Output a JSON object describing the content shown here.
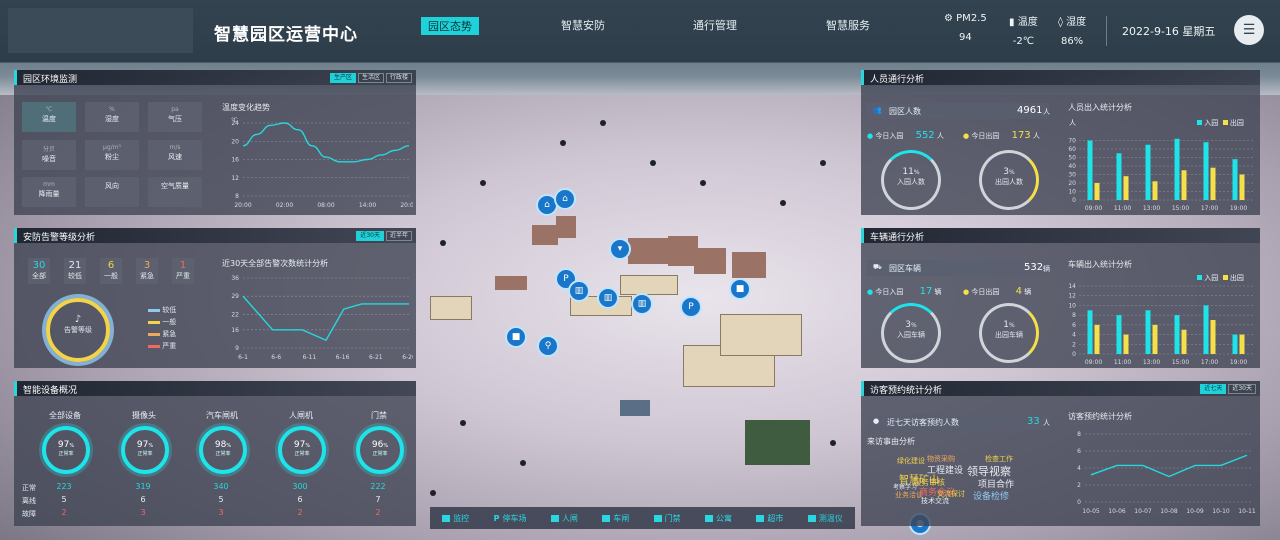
{
  "header": {
    "title": "智慧园区运营中心",
    "nav": [
      "园区态势",
      "智慧安防",
      "通行管理",
      "智慧服务"
    ],
    "active_nav": 0,
    "env": [
      {
        "label": "PM2.5",
        "value": "94",
        "icon": "pm25-icon"
      },
      {
        "label": "温度",
        "value": "-2℃",
        "icon": "thermometer-icon"
      },
      {
        "label": "湿度",
        "value": "86%",
        "icon": "humidity-icon"
      }
    ],
    "datetime": "2022-9-16 星期五"
  },
  "env_monitor": {
    "title": "园区环境监测",
    "tags": [
      "生产区",
      "生活区",
      "行政楼"
    ],
    "active_tag": 0,
    "cells": [
      {
        "unit": "℃",
        "label": "温度"
      },
      {
        "unit": "%",
        "label": "湿度"
      },
      {
        "unit": "pa",
        "label": "气压"
      },
      {
        "unit": "分贝",
        "label": "噪音"
      },
      {
        "unit": "μg/m³",
        "label": "粉尘"
      },
      {
        "unit": "m/s",
        "label": "风速"
      },
      {
        "unit": "mm",
        "label": "降雨量"
      },
      {
        "unit": "",
        "label": "风向"
      },
      {
        "unit": "",
        "label": "空气质量"
      }
    ],
    "chart_title": "温度变化趋势"
  },
  "alarm": {
    "title": "安防告警等级分析",
    "tags": [
      "近30天",
      "近半年"
    ],
    "active_tag": 0,
    "counts": [
      {
        "n": "30",
        "label": "全部",
        "color": "#27d7dc"
      },
      {
        "n": "21",
        "label": "较低",
        "color": "#e6eef2"
      },
      {
        "n": "6",
        "label": "一般",
        "color": "#f3d34a"
      },
      {
        "n": "3",
        "label": "紧急",
        "color": "#f0a85c"
      },
      {
        "n": "1",
        "label": "严重",
        "color": "#ef6b5c"
      }
    ],
    "gauge_label": "告警等级",
    "legend": [
      {
        "label": "较低",
        "color": "#8fc8f2"
      },
      {
        "label": "一般",
        "color": "#f3d34a"
      },
      {
        "label": "紧急",
        "color": "#f0a85c"
      },
      {
        "label": "严重",
        "color": "#ef6b5c"
      }
    ],
    "chart_title": "近30天全部告警次数统计分析"
  },
  "devices": {
    "title": "智能设备概况",
    "items": [
      {
        "name": "全部设备",
        "pct": "97",
        "normal": "223",
        "offline": "5",
        "fault": "2"
      },
      {
        "name": "摄像头",
        "pct": "97",
        "normal": "319",
        "offline": "6",
        "fault": "3"
      },
      {
        "name": "汽车闸机",
        "pct": "98",
        "normal": "340",
        "offline": "5",
        "fault": "3"
      },
      {
        "name": "人闸机",
        "pct": "97",
        "normal": "300",
        "offline": "6",
        "fault": "2"
      },
      {
        "name": "门禁",
        "pct": "96",
        "normal": "222",
        "offline": "7",
        "fault": "2"
      }
    ],
    "pct_unit": "%",
    "rate_label": "正常率",
    "row_labels": [
      "正常",
      "离线",
      "故障"
    ]
  },
  "people": {
    "title": "人员通行分析",
    "count_label": "园区人数",
    "count": "4961",
    "count_unit": "人",
    "in_label": "今日入园",
    "in_value": "552",
    "out_label": "今日出园",
    "out_value": "173",
    "unit": "人",
    "ring_in": {
      "pct": "11",
      "label": "入园人数"
    },
    "ring_out": {
      "pct": "3",
      "label": "出园人数"
    },
    "chart_title": "人员出入统计分析",
    "legend": [
      "入园",
      "出园"
    ],
    "yunit": "人"
  },
  "vehicles": {
    "title": "车辆通行分析",
    "count_label": "园区车辆",
    "count": "532",
    "count_unit": "辆",
    "in_label": "今日入园",
    "in_value": "17",
    "out_label": "今日出园",
    "out_value": "4",
    "unit": "辆",
    "ring_in": {
      "pct": "3",
      "label": "入园车辆"
    },
    "ring_out": {
      "pct": "1",
      "label": "出园车辆"
    },
    "chart_title": "车辆出入统计分析",
    "legend": [
      "入园",
      "出园"
    ]
  },
  "visitors": {
    "title": "访客预约统计分析",
    "tags": [
      "近七天",
      "近30天"
    ],
    "active_tag": 0,
    "count_label": "近七天访客预约人数",
    "count": "33",
    "count_unit": "人",
    "cloud_title": "来访事由分析",
    "words": [
      "领导视察",
      "工程建设",
      "物资采购",
      "项目合作",
      "智慧矿山",
      "绿化建设",
      "业务洽谈",
      "商务会议",
      "交流探讨",
      "技术交流",
      "服务审核",
      "设备检修",
      "检查工作",
      "考察学习"
    ],
    "chart_title": "访客预约统计分析"
  },
  "bottom_bar": [
    "监控",
    "停车场",
    "人闸",
    "车闸",
    "门禁",
    "公寓",
    "超市",
    "测温仪"
  ],
  "percent_sign": "%",
  "colors": {
    "accent": "#27d7dc",
    "in": "#1ee3e8",
    "out": "#f5e04a"
  },
  "chart_data": [
    {
      "type": "line",
      "id": "temp",
      "x": [
        "20:00",
        "02:00",
        "08:00",
        "14:00",
        "20:00"
      ],
      "xpos": [
        0,
        6,
        12,
        18,
        24
      ],
      "points": [
        [
          0,
          19
        ],
        [
          2,
          21.5
        ],
        [
          4,
          23.5
        ],
        [
          6,
          24
        ],
        [
          8,
          22.5
        ],
        [
          10,
          19
        ],
        [
          12,
          16.5
        ],
        [
          14,
          15.5
        ],
        [
          16,
          15.5
        ],
        [
          18,
          16
        ],
        [
          20,
          17
        ],
        [
          22,
          18
        ],
        [
          24,
          19
        ]
      ],
      "yticks": [
        8,
        12,
        16,
        20,
        24
      ],
      "ylim": [
        8,
        24
      ],
      "yunit": "℃"
    },
    {
      "type": "line",
      "id": "alarm",
      "x": [
        "6-1",
        "6-6",
        "6-11",
        "6-16",
        "6-21",
        "6-26"
      ],
      "points": [
        [
          0,
          29
        ],
        [
          5,
          16
        ],
        [
          10,
          16
        ],
        [
          14,
          12
        ],
        [
          17,
          24
        ],
        [
          20,
          26
        ],
        [
          25,
          26
        ],
        [
          28,
          26
        ]
      ],
      "yticks": [
        9,
        16,
        22,
        29,
        36
      ],
      "ylim": [
        9,
        36
      ]
    },
    {
      "type": "bar",
      "id": "people",
      "categories": [
        "09:00",
        "11:00",
        "13:00",
        "15:00",
        "17:00",
        "19:00"
      ],
      "series": [
        {
          "name": "入园",
          "values": [
            70,
            55,
            65,
            72,
            68,
            48
          ]
        },
        {
          "name": "出园",
          "values": [
            20,
            28,
            22,
            35,
            38,
            30
          ]
        }
      ],
      "yticks": [
        0,
        10,
        20,
        30,
        40,
        50,
        60,
        70
      ],
      "ylim": [
        0,
        80
      ]
    },
    {
      "type": "bar",
      "id": "vehicles",
      "categories": [
        "09:00",
        "11:00",
        "13:00",
        "15:00",
        "17:00",
        "19:00"
      ],
      "series": [
        {
          "name": "入园",
          "values": [
            9,
            8,
            9,
            8,
            10,
            4
          ]
        },
        {
          "name": "出园",
          "values": [
            6,
            4,
            6,
            5,
            7,
            4
          ]
        }
      ],
      "yticks": [
        0,
        2,
        4,
        6,
        8,
        10,
        12,
        14
      ],
      "ylim": [
        0,
        14
      ]
    },
    {
      "type": "line",
      "id": "visitors",
      "x": [
        "10-05",
        "10-06",
        "10-07",
        "10-08",
        "10-09",
        "10-10",
        "10-11"
      ],
      "values": [
        3.2,
        4.3,
        4.3,
        3.0,
        4.3,
        4.3,
        5.5
      ],
      "yticks": [
        0,
        2,
        4,
        6,
        8
      ],
      "ylim": [
        0,
        8
      ]
    }
  ]
}
